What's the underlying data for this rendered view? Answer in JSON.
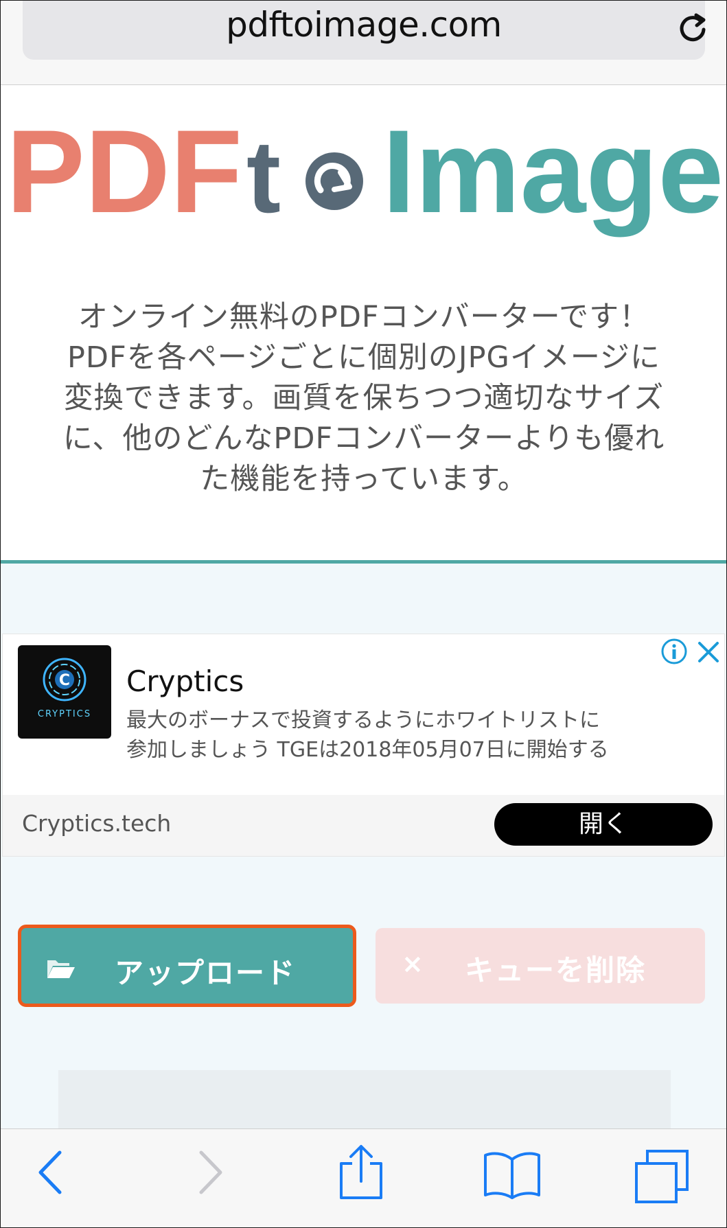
{
  "browser": {
    "url": "pdftoimage.com",
    "reload_icon": "reload-icon"
  },
  "logo": {
    "part1": "PDF",
    "part2": "t",
    "part3": "Image",
    "colors": {
      "pdf": "#e8806f",
      "to": "#586977",
      "image": "#4fa8a4"
    }
  },
  "intro": {
    "lines": [
      "オンライン無料のPDFコンバーターです！",
      "PDFを各ページごとに個別のJPGイメージに",
      "変換できます。画質を保ちつつ適切なサイズ",
      "に、他のどんなPDFコンバーターよりも優れ",
      "た機能を持っています。"
    ]
  },
  "ad": {
    "logo_text": "CRYPTICS",
    "title": "Cryptics",
    "description_lines": [
      "最大のボーナスで投資するようにホワイトリストに",
      "参加しましょう TGEは2018年05月07日に開始する"
    ],
    "domain": "Cryptics.tech",
    "open_label": "開く"
  },
  "actions": {
    "upload_label": "アップロード",
    "clear_label": "キューを削除",
    "clear_icon": "×"
  },
  "toolbar": {
    "items": [
      "back-icon",
      "forward-icon",
      "share-icon",
      "bookmarks-icon",
      "tabs-icon"
    ]
  },
  "colors": {
    "teal": "#4fa8a4",
    "orange_highlight": "#ec5a1c",
    "ios_blue": "#1a7cf5"
  }
}
